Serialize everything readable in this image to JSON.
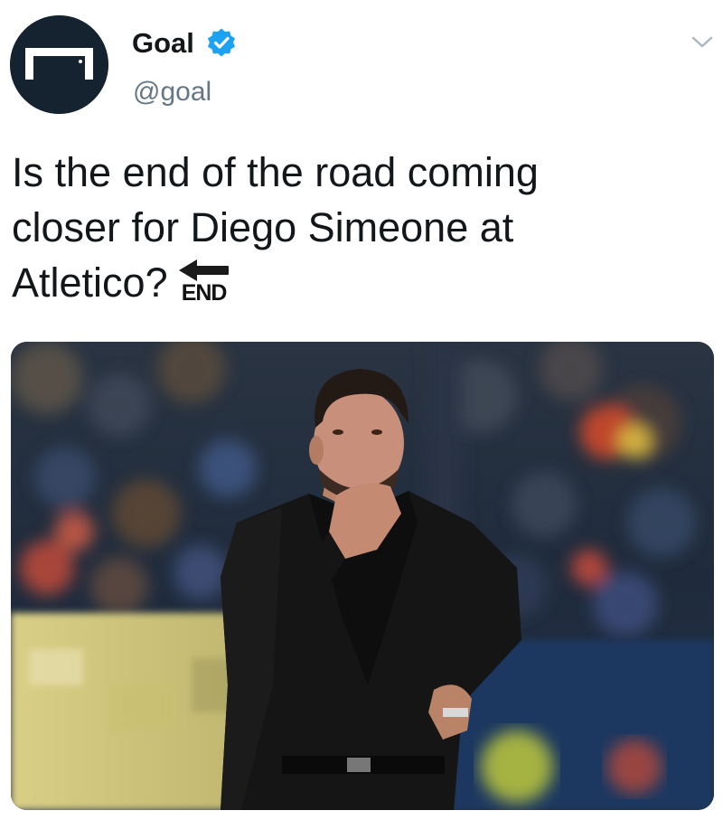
{
  "author": {
    "display_name": "Goal",
    "handle": "@goal",
    "verified": true,
    "avatar_icon": "goal-logo-icon",
    "avatar_color": "#152230"
  },
  "tweet": {
    "text_lines": [
      "Is the end of the road coming",
      "closer for Diego Simeone at",
      "Atletico?"
    ],
    "emoji_label": "END",
    "emoji_icon": "end-arrow-icon"
  },
  "menu": {
    "icon": "chevron-down-icon"
  },
  "media": {
    "type": "photo"
  },
  "colors": {
    "text": "#14171a",
    "secondary_text": "#657786",
    "verified_badge": "#1da1f2"
  }
}
